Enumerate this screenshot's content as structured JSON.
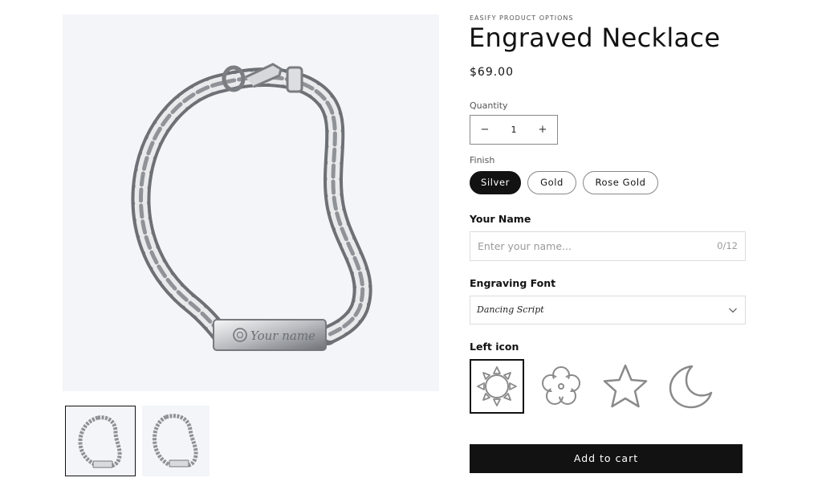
{
  "gallery": {
    "main_alt": "Engraved Necklace product image",
    "engraving_text": "Your name"
  },
  "product": {
    "vendor": "EASIFY PRODUCT OPTIONS",
    "title": "Engraved Necklace",
    "price": "$69.00"
  },
  "quantity": {
    "label": "Quantity",
    "minus": "−",
    "value": "1",
    "plus": "+"
  },
  "finish": {
    "label": "Finish",
    "options": [
      "Silver",
      "Gold",
      "Rose Gold"
    ],
    "selected": "Silver"
  },
  "your_name": {
    "heading": "Your Name",
    "placeholder": "Enter your name...",
    "counter": "0/12"
  },
  "engraving_font": {
    "heading": "Engraving Font",
    "value": "Dancing Script"
  },
  "left_icon": {
    "heading": "Left icon",
    "options": [
      "sun-icon",
      "flower-icon",
      "star-icon",
      "moon-icon"
    ],
    "selected": "sun-icon"
  },
  "cart": {
    "label": "Add to cart"
  },
  "colors": {
    "accent": "#121212",
    "gallery_bg": "#f3f5f8",
    "icon_gray": "#8a8a8a"
  }
}
